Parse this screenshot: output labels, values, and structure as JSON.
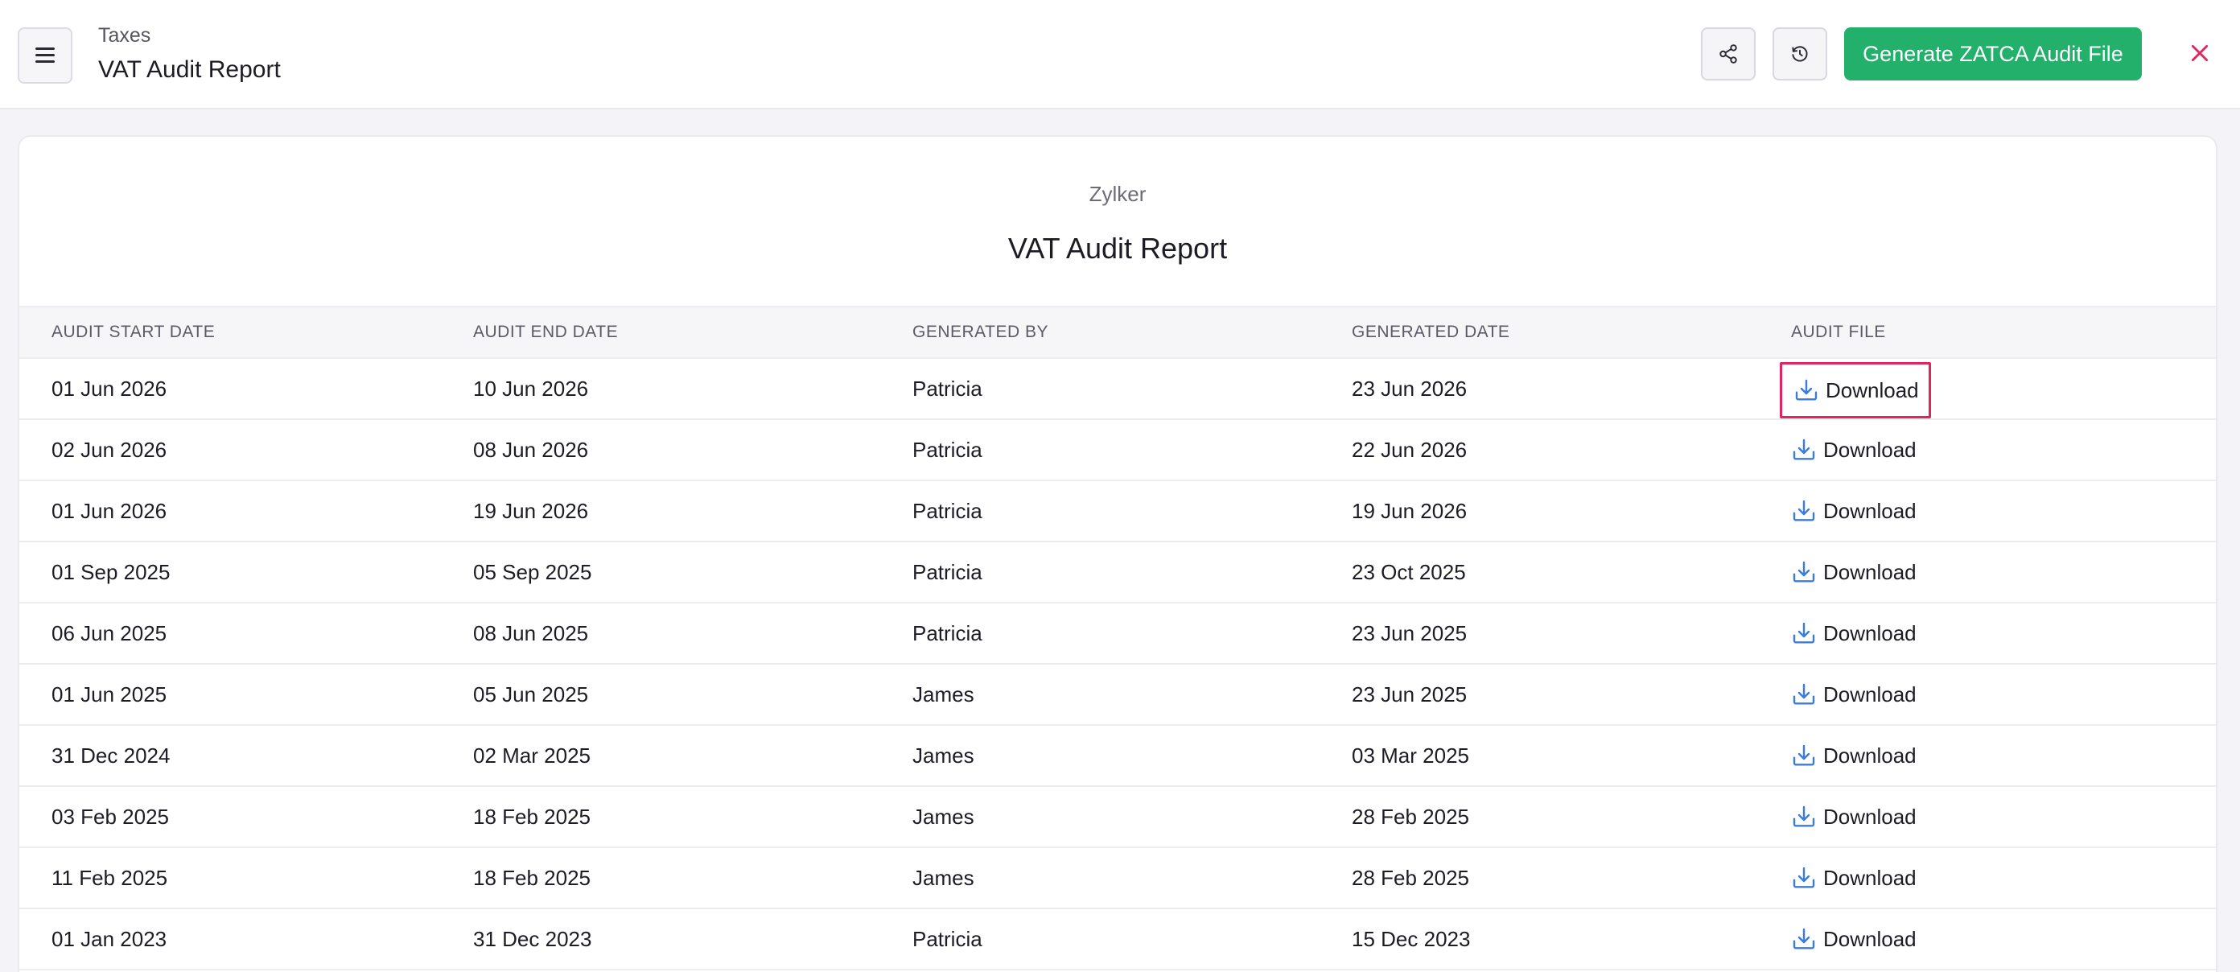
{
  "header": {
    "breadcrumb": "Taxes",
    "title": "VAT Audit Report",
    "primary_button": "Generate ZATCA Audit File"
  },
  "report": {
    "organization": "Zylker",
    "title": "VAT Audit Report",
    "columns": [
      "AUDIT START DATE",
      "AUDIT END DATE",
      "GENERATED BY",
      "GENERATED DATE",
      "AUDIT FILE"
    ],
    "rows": [
      {
        "start": "01 Jun 2026",
        "end": "10 Jun 2026",
        "by": "Patricia",
        "generated": "23 Jun 2026",
        "file": "Download"
      },
      {
        "start": "02 Jun 2026",
        "end": "08 Jun 2026",
        "by": "Patricia",
        "generated": "22 Jun 2026",
        "file": "Download"
      },
      {
        "start": "01 Jun 2026",
        "end": "19 Jun 2026",
        "by": "Patricia",
        "generated": "19 Jun 2026",
        "file": "Download"
      },
      {
        "start": "01 Sep 2025",
        "end": "05 Sep 2025",
        "by": "Patricia",
        "generated": "23 Oct 2025",
        "file": "Download"
      },
      {
        "start": "06 Jun 2025",
        "end": "08 Jun 2025",
        "by": "Patricia",
        "generated": "23 Jun 2025",
        "file": "Download"
      },
      {
        "start": "01 Jun 2025",
        "end": "05 Jun 2025",
        "by": "James",
        "generated": "23 Jun 2025",
        "file": "Download"
      },
      {
        "start": "31 Dec 2024",
        "end": "02 Mar 2025",
        "by": "James",
        "generated": "03 Mar 2025",
        "file": "Download"
      },
      {
        "start": "03 Feb 2025",
        "end": "18 Feb 2025",
        "by": "James",
        "generated": "28 Feb 2025",
        "file": "Download"
      },
      {
        "start": "11 Feb 2025",
        "end": "18 Feb 2025",
        "by": "James",
        "generated": "28 Feb 2025",
        "file": "Download"
      },
      {
        "start": "01 Jan 2023",
        "end": "31 Dec 2023",
        "by": "Patricia",
        "generated": "15 Dec 2023",
        "file": "Download"
      }
    ]
  },
  "icons": {
    "menu": "hamburger-menu-icon",
    "share": "share-icon",
    "history": "history-icon",
    "close": "close-icon",
    "download": "download-icon"
  },
  "colors": {
    "primary": "#23b06b",
    "close": "#e0245e",
    "download_icon": "#3a7be0",
    "highlight": "#e0245e"
  }
}
